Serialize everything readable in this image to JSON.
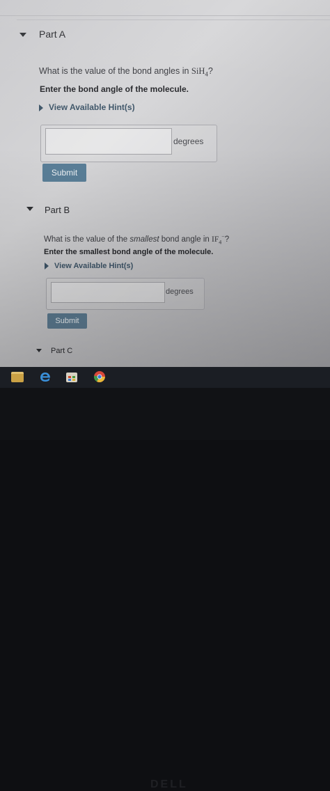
{
  "partA": {
    "title": "Part A",
    "question_prefix": "What is the value of the bond angles in ",
    "formula": "SiH",
    "formula_sub": "4",
    "question_suffix": "?",
    "instruction": "Enter the bond angle of the molecule.",
    "hint_label": "View Available Hint(s)",
    "answer_value": "",
    "unit": "degrees",
    "submit_label": "Submit"
  },
  "partB": {
    "title": "Part B",
    "question_prefix": "What is the value of the ",
    "question_emph": "smallest",
    "question_mid": " bond angle in ",
    "formula": "IF",
    "formula_sub": "4",
    "formula_sup": "−",
    "question_suffix": "?",
    "instruction": "Enter the smallest bond angle of the molecule.",
    "hint_label": "View Available Hint(s)",
    "answer_value": "",
    "unit": "degrees",
    "submit_label": "Submit"
  },
  "partC": {
    "title": "Part C"
  },
  "taskbar": {
    "icons": [
      "file-explorer-icon",
      "edge-icon",
      "store-icon",
      "chrome-icon"
    ]
  },
  "monitor": {
    "brand": "DELL"
  }
}
